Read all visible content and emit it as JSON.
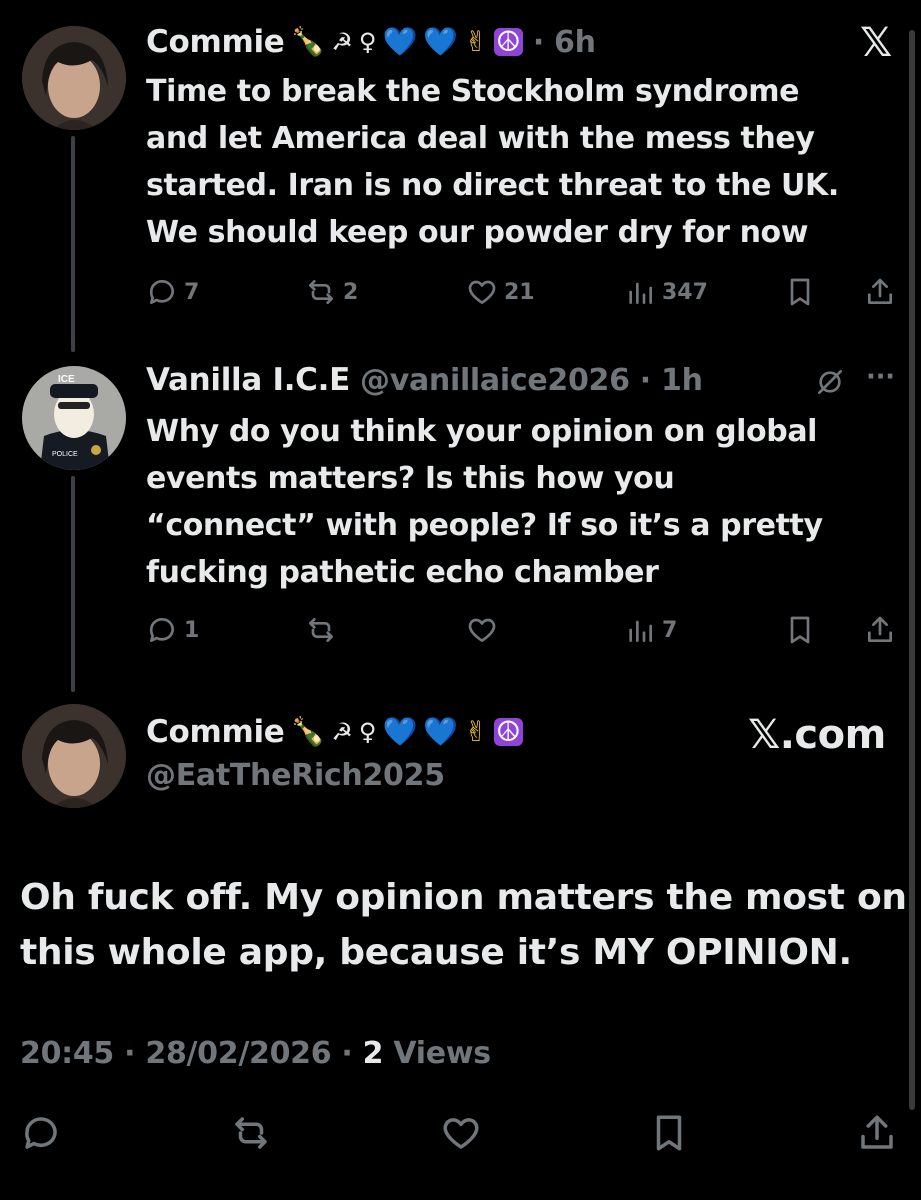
{
  "tweet1": {
    "name": "Commie",
    "emojis": [
      "🍾",
      "☭",
      "♀",
      "💙",
      "💙",
      "✌",
      "☮"
    ],
    "time": "· 6h",
    "lines": [
      "Time to break the Stockholm syndrome",
      "and let America deal with the mess they",
      "started. Iran is no direct threat to the UK.",
      "We should keep our powder dry for now"
    ],
    "replies": "7",
    "reposts": "2",
    "likes": "21",
    "views": "347"
  },
  "tweet2": {
    "name": "Vanilla I.C.E",
    "handle_time": "@vanillaice2026 · 1h",
    "more": "···",
    "lines": [
      "Why do you think your opinion on global",
      "events matters? Is this how you",
      "“connect” with people? If so it’s a pretty",
      "fucking pathetic echo chamber"
    ],
    "replies": "1",
    "views": "7"
  },
  "tweet3": {
    "name": "Commie",
    "emojis": [
      "🍾",
      "☭",
      "♀",
      "💙",
      "💙",
      "✌",
      "☮"
    ],
    "handle": "@EatTheRich2025",
    "brand": "𝕏.com",
    "lines": [
      "Oh fuck off. My opinion matters the most on",
      "this whole app, because it’s MY OPINION."
    ],
    "time": "20:45 · 28/02/2026 · ",
    "views_count": "2",
    "views_label": " Views"
  },
  "x_logo": "𝕏",
  "colors": {
    "background": "#000000",
    "text": "#e7e9ea",
    "muted": "#71767b"
  }
}
